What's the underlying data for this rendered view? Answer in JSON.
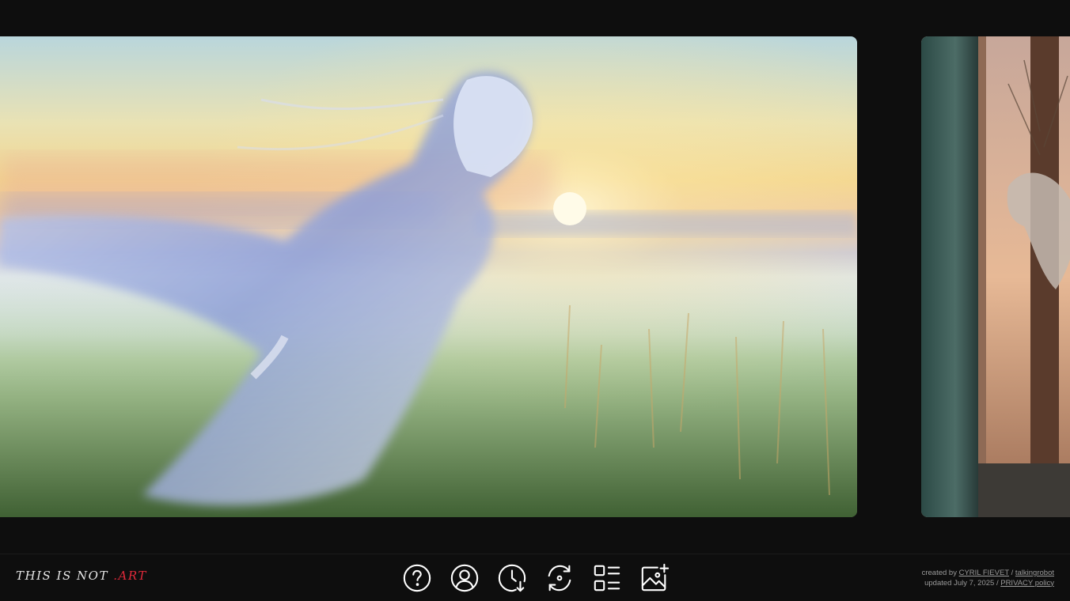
{
  "gallery": {
    "main_image": {
      "alt": "Ghostly woman flowing over a wheat field at sunrise"
    },
    "next_image": {
      "alt": "Figure with fabric between stone pillars"
    }
  },
  "footer": {
    "logo": {
      "text": "THIS IS NOT ",
      "accent": ".ART",
      "accent_color": "#e0293a"
    },
    "toolbar": [
      {
        "name": "help-button",
        "icon": "question-circle-icon"
      },
      {
        "name": "account-button",
        "icon": "user-circle-icon"
      },
      {
        "name": "history-button",
        "icon": "clock-download-icon"
      },
      {
        "name": "refresh-button",
        "icon": "refresh-icon"
      },
      {
        "name": "list-view-button",
        "icon": "list-grid-icon"
      },
      {
        "name": "add-image-button",
        "icon": "image-plus-icon"
      }
    ],
    "credits": {
      "created_prefix": "created by ",
      "author": "CYRIL FIEVET",
      "separator1": " / ",
      "company": "talkingrobot",
      "updated": "updated July 7, 2025",
      "separator2": " / ",
      "privacy": "PRIVACY policy"
    }
  }
}
